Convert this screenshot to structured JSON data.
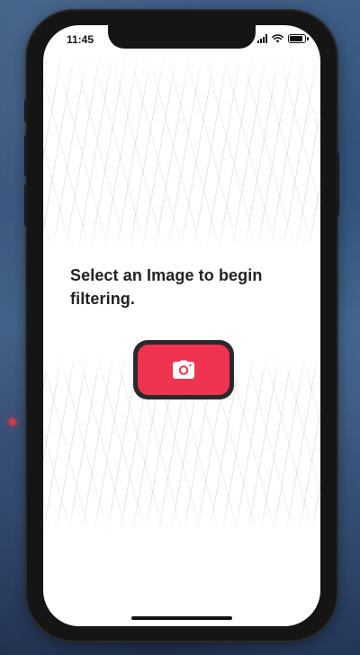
{
  "status_bar": {
    "time": "11:45"
  },
  "main": {
    "prompt": "Select an Image to begin filtering.",
    "camera_button": {
      "icon": "camera-icon",
      "color": "#f0334f"
    }
  },
  "colors": {
    "accent": "#f0334f",
    "background": "#ffffff",
    "text": "#222222"
  }
}
